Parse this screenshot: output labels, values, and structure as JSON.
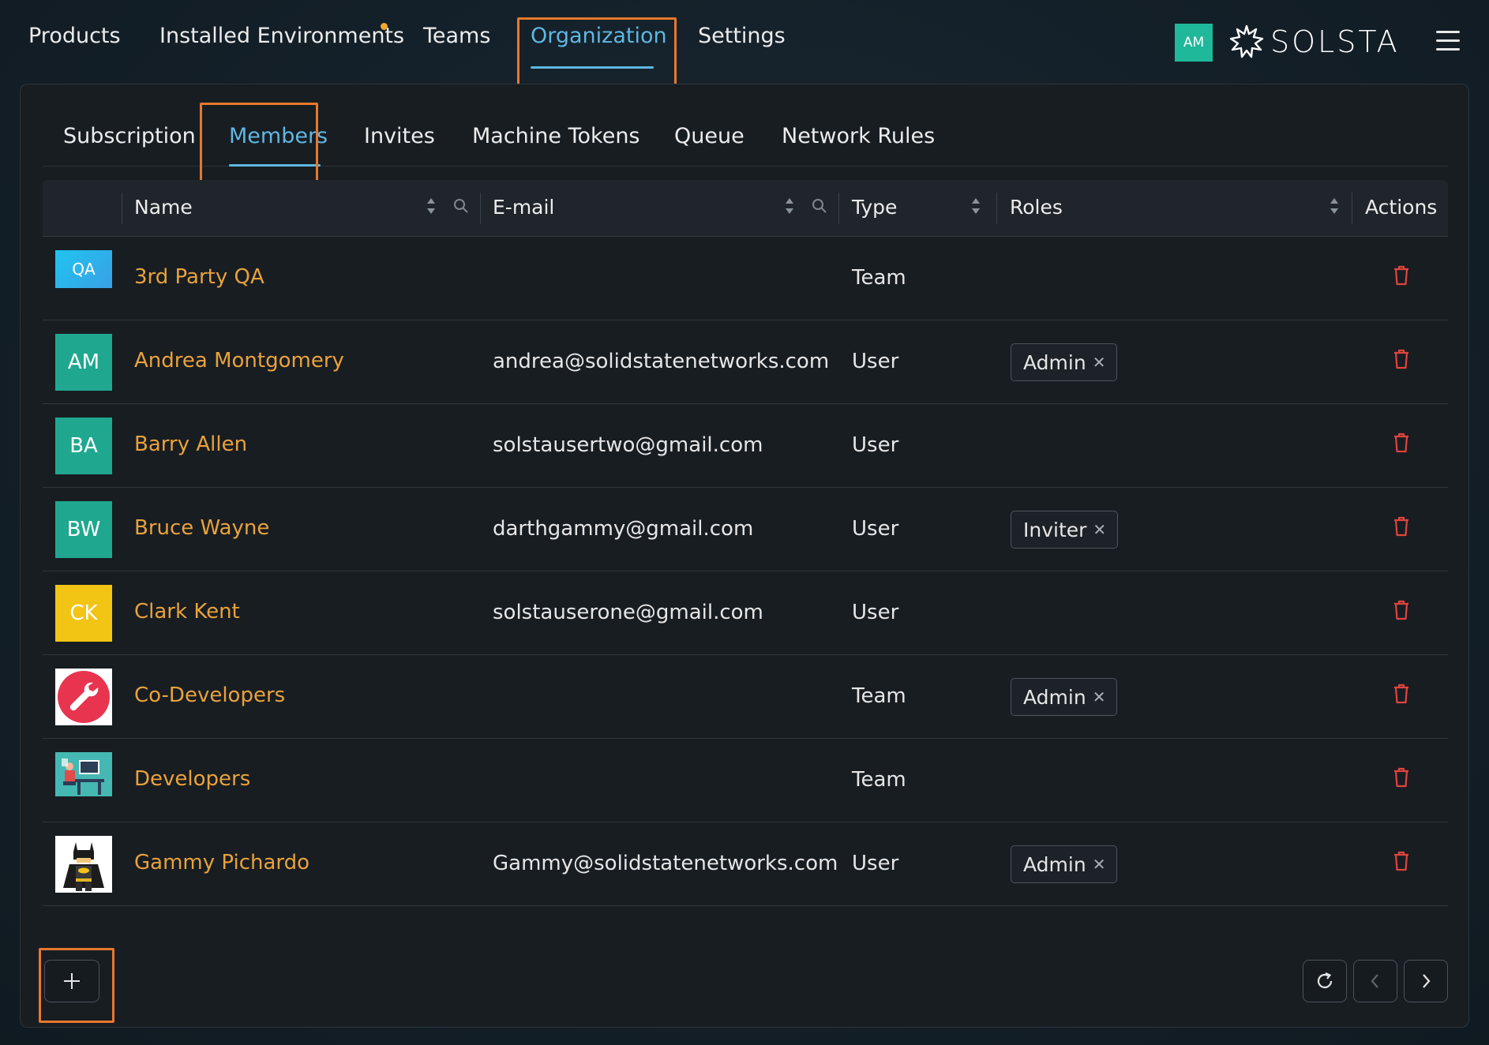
{
  "topnav": {
    "items": [
      {
        "label": "Products"
      },
      {
        "label": "Installed Environments"
      },
      {
        "label": "Teams"
      },
      {
        "label": "Organization"
      },
      {
        "label": "Settings"
      }
    ],
    "active": "Organization",
    "user_initials": "AM",
    "brand": "SOLSTA"
  },
  "subtabs": {
    "items": [
      {
        "label": "Subscription"
      },
      {
        "label": "Members"
      },
      {
        "label": "Invites"
      },
      {
        "label": "Machine Tokens"
      },
      {
        "label": "Queue"
      },
      {
        "label": "Network Rules"
      }
    ],
    "active": "Members"
  },
  "table": {
    "columns": {
      "name": "Name",
      "email": "E-mail",
      "type": "Type",
      "roles": "Roles",
      "actions": "Actions"
    },
    "rows": [
      {
        "avatar_text": "QA",
        "avatar_kind": "qa",
        "name": "3rd Party QA",
        "email": "",
        "type": "Team",
        "role": ""
      },
      {
        "avatar_text": "AM",
        "avatar_kind": "teal",
        "name": "Andrea Montgomery",
        "email": "andrea@solidstatenetworks.com",
        "type": "User",
        "role": "Admin"
      },
      {
        "avatar_text": "BA",
        "avatar_kind": "teal",
        "name": "Barry Allen",
        "email": "solstausertwo@gmail.com",
        "type": "User",
        "role": ""
      },
      {
        "avatar_text": "BW",
        "avatar_kind": "teal",
        "name": "Bruce Wayne",
        "email": "darthgammy@gmail.com",
        "type": "User",
        "role": "Inviter"
      },
      {
        "avatar_text": "CK",
        "avatar_kind": "yellow",
        "name": "Clark Kent",
        "email": "solstauserone@gmail.com",
        "type": "User",
        "role": ""
      },
      {
        "avatar_text": "",
        "avatar_kind": "wrench",
        "name": "Co-Developers",
        "email": "",
        "type": "Team",
        "role": "Admin"
      },
      {
        "avatar_text": "",
        "avatar_kind": "developers",
        "name": "Developers",
        "email": "",
        "type": "Team",
        "role": ""
      },
      {
        "avatar_text": "",
        "avatar_kind": "batman",
        "name": "Gammy Pichardo",
        "email": "Gammy@solidstatenetworks.com",
        "type": "User",
        "role": "Admin"
      }
    ]
  },
  "icons": {
    "add": "plus-icon",
    "refresh": "refresh-icon",
    "prev": "chevron-left-icon",
    "next": "chevron-right-icon",
    "delete": "trash-icon",
    "sort": "sort-icon",
    "search": "search-icon",
    "menu": "hamburger-icon"
  },
  "colors": {
    "accent_blue": "#5fb7e2",
    "name_orange": "#e9a23b",
    "avatar_teal": "#1fa88f",
    "avatar_yellow": "#f2c414",
    "delete_red": "#e0443e",
    "highlight_orange": "#e8782d",
    "notification_dot": "#f0a92a"
  }
}
